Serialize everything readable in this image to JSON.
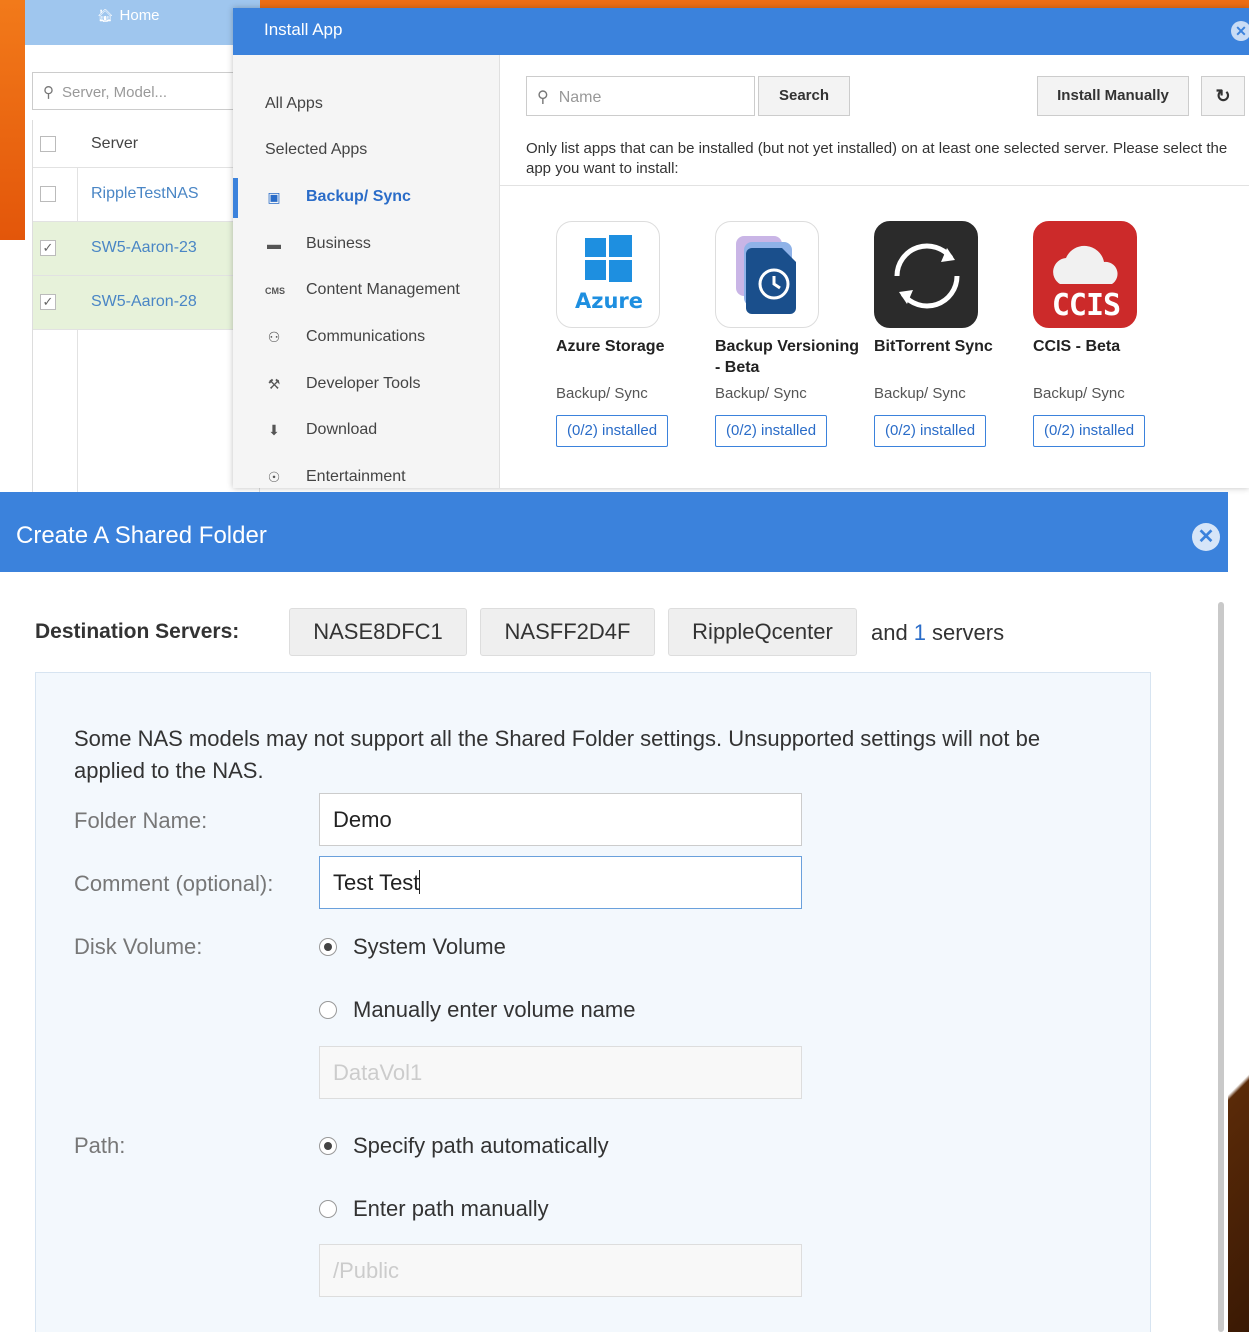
{
  "background": {
    "home_label": "Home",
    "search_placeholder": "Server, Model...",
    "table_header": "Server",
    "servers": [
      {
        "name": "RippleTestNAS",
        "checked": false
      },
      {
        "name": "SW5-Aaron-23",
        "checked": true
      },
      {
        "name": "SW5-Aaron-28",
        "checked": true
      }
    ]
  },
  "install_app": {
    "title": "Install App",
    "nav": [
      {
        "label": "All Apps",
        "icon": ""
      },
      {
        "label": "Selected Apps",
        "icon": ""
      },
      {
        "label": "Backup/ Sync",
        "icon": "backup-icon",
        "active": true
      },
      {
        "label": "Business",
        "icon": "briefcase-icon"
      },
      {
        "label": "Content Management",
        "icon": "cms-icon"
      },
      {
        "label": "Communications",
        "icon": "people-icon"
      },
      {
        "label": "Developer Tools",
        "icon": "hammer-icon"
      },
      {
        "label": "Download",
        "icon": "download-icon"
      },
      {
        "label": "Entertainment",
        "icon": "gamepad-icon"
      }
    ],
    "search_placeholder": "Name",
    "search_button": "Search",
    "install_manually_button": "Install Manually",
    "refresh_icon": "refresh-icon",
    "note": "Only list apps that can be installed (but not yet installed) on at least one selected server. Please select the app you want to install:",
    "apps": [
      {
        "name": "Azure Storage",
        "category": "Backup/ Sync",
        "installed": "(0/2) installed",
        "icon_text": "Azure"
      },
      {
        "name": "Backup Versioning - Beta",
        "category": "Backup/ Sync",
        "installed": "(0/2) installed"
      },
      {
        "name": "BitTorrent Sync",
        "category": "Backup/ Sync",
        "installed": "(0/2) installed"
      },
      {
        "name": "CCIS - Beta",
        "category": "Backup/ Sync",
        "installed": "(0/2) installed",
        "icon_text": "CCIS"
      }
    ]
  },
  "create_folder": {
    "title": "Create A Shared Folder",
    "destination_label": "Destination Servers:",
    "destination_servers": [
      "NASE8DFC1",
      "NASFF2D4F",
      "RippleQcenter"
    ],
    "more_prefix": "and",
    "more_count": "1",
    "more_suffix": "servers",
    "note": "Some NAS models may not support all the Shared Folder settings. Unsupported settings will not be applied to the NAS.",
    "folder_name_label": "Folder Name:",
    "folder_name_value": "Demo",
    "comment_label": "Comment (optional):",
    "comment_value": "Test Test",
    "disk_volume_label": "Disk Volume:",
    "disk_volume_options": [
      "System Volume",
      "Manually enter volume name"
    ],
    "disk_volume_selected": 0,
    "volume_name_placeholder": "DataVol1",
    "path_label": "Path:",
    "path_options": [
      "Specify path automatically",
      "Enter path manually"
    ],
    "path_selected": 0,
    "path_placeholder": "/Public"
  },
  "colors": {
    "accent": "#3b82dc",
    "desktop_orange": "#ee6e14",
    "selected_row": "#e7f2da"
  }
}
